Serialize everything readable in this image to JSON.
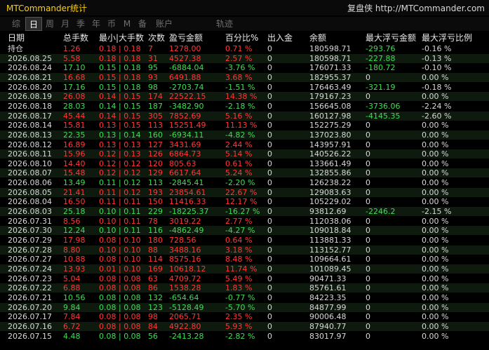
{
  "app": {
    "title": "MTCommander统计",
    "brand": "复盘侠 http://MTCommander.com"
  },
  "tabs": [
    {
      "label": "综",
      "active": false
    },
    {
      "label": "日",
      "active": true
    },
    {
      "label": "周",
      "active": false
    },
    {
      "label": "月",
      "active": false
    },
    {
      "label": "季",
      "active": false
    },
    {
      "label": "年",
      "active": false
    },
    {
      "label": "币",
      "active": false
    },
    {
      "label": "M",
      "active": false
    },
    {
      "label": "备",
      "active": false
    },
    {
      "label": "账户",
      "active": false
    },
    {
      "label": "轨迹",
      "active": false
    }
  ],
  "columns": [
    "日期",
    "总手数",
    "最小|大手数",
    "次数",
    "盈亏金额",
    "百分比%",
    "出入金",
    "余额",
    "最大浮亏金额",
    "最大浮亏比例"
  ],
  "holding_label": "持仓",
  "rows": [
    {
      "date": "2026.08.25",
      "lots": "5.58",
      "minmax": "0.18 | 0.18",
      "count": "31",
      "pnl": "4527.38",
      "pct": "2.57 %",
      "dep": "0",
      "bal": "180598.71",
      "float": "-227.88",
      "floatpct": "-0.13 %",
      "dir": "up"
    },
    {
      "date": "2026.08.24",
      "lots": "17.10",
      "minmax": "0.15 | 0.18",
      "count": "95",
      "pnl": "-6884.04",
      "pct": "-3.76 %",
      "dep": "0",
      "bal": "176071.33",
      "float": "-180.72",
      "floatpct": "-0.10 %",
      "dir": "dn"
    },
    {
      "date": "2026.08.21",
      "lots": "16.68",
      "minmax": "0.15 | 0.18",
      "count": "93",
      "pnl": "6491.88",
      "pct": "3.68 %",
      "dep": "0",
      "bal": "182955.37",
      "float": "0",
      "floatpct": "0.00 %",
      "dir": "up"
    },
    {
      "date": "2026.08.20",
      "lots": "17.16",
      "minmax": "0.15 | 0.18",
      "count": "98",
      "pnl": "-2703.74",
      "pct": "-1.51 %",
      "dep": "0",
      "bal": "176463.49",
      "float": "-321.19",
      "floatpct": "-0.18 %",
      "dir": "dn"
    },
    {
      "date": "2026.08.19",
      "lots": "26.08",
      "minmax": "0.14 | 0.15",
      "count": "174",
      "pnl": "22522.15",
      "pct": "14.38 %",
      "dep": "0",
      "bal": "179167.23",
      "float": "0",
      "floatpct": "0.00 %",
      "dir": "up"
    },
    {
      "date": "2026.08.18",
      "lots": "28.03",
      "minmax": "0.14 | 0.15",
      "count": "187",
      "pnl": "-3482.90",
      "pct": "-2.18 %",
      "dep": "0",
      "bal": "156645.08",
      "float": "-3736.06",
      "floatpct": "-2.24 %",
      "dir": "dn"
    },
    {
      "date": "2026.08.17",
      "lots": "45.44",
      "minmax": "0.14 | 0.15",
      "count": "305",
      "pnl": "7852.69",
      "pct": "5.16 %",
      "dep": "0",
      "bal": "160127.98",
      "float": "-4145.35",
      "floatpct": "-2.60 %",
      "dir": "up"
    },
    {
      "date": "2026.08.14",
      "lots": "15.81",
      "minmax": "0.13 | 0.15",
      "count": "113",
      "pnl": "15251.49",
      "pct": "11.13 %",
      "dep": "0",
      "bal": "152275.29",
      "float": "0",
      "floatpct": "0.00 %",
      "dir": "up"
    },
    {
      "date": "2026.08.13",
      "lots": "22.35",
      "minmax": "0.13 | 0.14",
      "count": "160",
      "pnl": "-6934.11",
      "pct": "-4.82 %",
      "dep": "0",
      "bal": "137023.80",
      "float": "0",
      "floatpct": "0.00 %",
      "dir": "dn"
    },
    {
      "date": "2026.08.12",
      "lots": "16.89",
      "minmax": "0.13 | 0.13",
      "count": "127",
      "pnl": "3431.69",
      "pct": "2.44 %",
      "dep": "0",
      "bal": "143957.91",
      "float": "0",
      "floatpct": "0.00 %",
      "dir": "up"
    },
    {
      "date": "2026.08.11",
      "lots": "15.96",
      "minmax": "0.12 | 0.13",
      "count": "126",
      "pnl": "6864.73",
      "pct": "5.14 %",
      "dep": "0",
      "bal": "140526.22",
      "float": "0",
      "floatpct": "0.00 %",
      "dir": "up"
    },
    {
      "date": "2026.08.10",
      "lots": "14.40",
      "minmax": "0.12 | 0.12",
      "count": "120",
      "pnl": "805.63",
      "pct": "0.61 %",
      "dep": "0",
      "bal": "133661.49",
      "float": "0",
      "floatpct": "0.00 %",
      "dir": "up"
    },
    {
      "date": "2026.08.07",
      "lots": "15.48",
      "minmax": "0.12 | 0.12",
      "count": "129",
      "pnl": "6617.64",
      "pct": "5.24 %",
      "dep": "0",
      "bal": "132855.86",
      "float": "0",
      "floatpct": "0.00 %",
      "dir": "up"
    },
    {
      "date": "2026.08.06",
      "lots": "13.49",
      "minmax": "0.11 | 0.12",
      "count": "113",
      "pnl": "-2845.41",
      "pct": "-2.20 %",
      "dep": "0",
      "bal": "126238.22",
      "float": "0",
      "floatpct": "0.00 %",
      "dir": "dn"
    },
    {
      "date": "2026.08.05",
      "lots": "21.41",
      "minmax": "0.11 | 0.12",
      "count": "193",
      "pnl": "23854.61",
      "pct": "22.67 %",
      "dep": "0",
      "bal": "129083.63",
      "float": "0",
      "floatpct": "0.00 %",
      "dir": "up"
    },
    {
      "date": "2026.08.04",
      "lots": "16.50",
      "minmax": "0.11 | 0.11",
      "count": "150",
      "pnl": "11416.33",
      "pct": "12.17 %",
      "dep": "0",
      "bal": "105229.02",
      "float": "0",
      "floatpct": "0.00 %",
      "dir": "up"
    },
    {
      "date": "2026.08.03",
      "lots": "25.18",
      "minmax": "0.10 | 0.11",
      "count": "229",
      "pnl": "-18225.37",
      "pct": "-16.27 %",
      "dep": "0",
      "bal": "93812.69",
      "float": "-2246.2",
      "floatpct": "-2.15 %",
      "dir": "dn"
    },
    {
      "date": "2026.07.31",
      "lots": "8.56",
      "minmax": "0.10 | 0.11",
      "count": "78",
      "pnl": "3019.22",
      "pct": "2.77 %",
      "dep": "0",
      "bal": "112038.06",
      "float": "0",
      "floatpct": "0.00 %",
      "dir": "up"
    },
    {
      "date": "2026.07.30",
      "lots": "12.24",
      "minmax": "0.10 | 0.11",
      "count": "116",
      "pnl": "-4862.49",
      "pct": "-4.27 %",
      "dep": "0",
      "bal": "109018.84",
      "float": "0",
      "floatpct": "0.00 %",
      "dir": "dn"
    },
    {
      "date": "2026.07.29",
      "lots": "17.98",
      "minmax": "0.08 | 0.10",
      "count": "180",
      "pnl": "728.56",
      "pct": "0.64 %",
      "dep": "0",
      "bal": "113881.33",
      "float": "0",
      "floatpct": "0.00 %",
      "dir": "up"
    },
    {
      "date": "2026.07.28",
      "lots": "8.80",
      "minmax": "0.10 | 0.10",
      "count": "88",
      "pnl": "3488.16",
      "pct": "3.18 %",
      "dep": "0",
      "bal": "113152.77",
      "float": "0",
      "floatpct": "0.00 %",
      "dir": "up"
    },
    {
      "date": "2026.07.27",
      "lots": "10.88",
      "minmax": "0.08 | 0.10",
      "count": "114",
      "pnl": "8575.16",
      "pct": "8.48 %",
      "dep": "0",
      "bal": "109664.61",
      "float": "0",
      "floatpct": "0.00 %",
      "dir": "up"
    },
    {
      "date": "2026.07.24",
      "lots": "13.93",
      "minmax": "0.01 | 0.10",
      "count": "169",
      "pnl": "10618.12",
      "pct": "11.74 %",
      "dep": "0",
      "bal": "101089.45",
      "float": "0",
      "floatpct": "0.00 %",
      "dir": "up"
    },
    {
      "date": "2026.07.23",
      "lots": "5.04",
      "minmax": "0.08 | 0.08",
      "count": "63",
      "pnl": "4709.72",
      "pct": "5.49 %",
      "dep": "0",
      "bal": "90471.33",
      "float": "0",
      "floatpct": "0.00 %",
      "dir": "up"
    },
    {
      "date": "2026.07.22",
      "lots": "6.88",
      "minmax": "0.08 | 0.08",
      "count": "86",
      "pnl": "1538.28",
      "pct": "1.83 %",
      "dep": "0",
      "bal": "85761.61",
      "float": "0",
      "floatpct": "0.00 %",
      "dir": "up"
    },
    {
      "date": "2026.07.21",
      "lots": "10.56",
      "minmax": "0.08 | 0.08",
      "count": "132",
      "pnl": "-654.64",
      "pct": "-0.77 %",
      "dep": "0",
      "bal": "84223.35",
      "float": "0",
      "floatpct": "0.00 %",
      "dir": "dn"
    },
    {
      "date": "2026.07.20",
      "lots": "9.84",
      "minmax": "0.08 | 0.08",
      "count": "123",
      "pnl": "-5128.49",
      "pct": "-5.70 %",
      "dep": "0",
      "bal": "84877.99",
      "float": "0",
      "floatpct": "0.00 %",
      "dir": "dn"
    },
    {
      "date": "2026.07.17",
      "lots": "7.84",
      "minmax": "0.08 | 0.08",
      "count": "98",
      "pnl": "2065.71",
      "pct": "2.35 %",
      "dep": "0",
      "bal": "90006.48",
      "float": "0",
      "floatpct": "0.00 %",
      "dir": "up"
    },
    {
      "date": "2026.07.16",
      "lots": "6.72",
      "minmax": "0.08 | 0.08",
      "count": "84",
      "pnl": "4922.80",
      "pct": "5.93 %",
      "dep": "0",
      "bal": "87940.77",
      "float": "0",
      "floatpct": "0.00 %",
      "dir": "up"
    },
    {
      "date": "2026.07.15",
      "lots": "4.48",
      "minmax": "0.08 | 0.08",
      "count": "56",
      "pnl": "-2413.28",
      "pct": "-2.82 %",
      "dep": "0",
      "bal": "83017.97",
      "float": "0",
      "floatpct": "0.00 %",
      "dir": "dn"
    }
  ],
  "holding": {
    "lots": "1.26",
    "minmax": "0.18 | 0.18",
    "count": "7",
    "pnl": "1278.00",
    "pct": "0.71 %",
    "dep": "0",
    "bal": "180598.71",
    "float": "-293.76",
    "floatpct": "-0.16 %"
  },
  "colors": {
    "profit": "#ff3838",
    "loss": "#3fdc55",
    "title": "#ffd000"
  }
}
